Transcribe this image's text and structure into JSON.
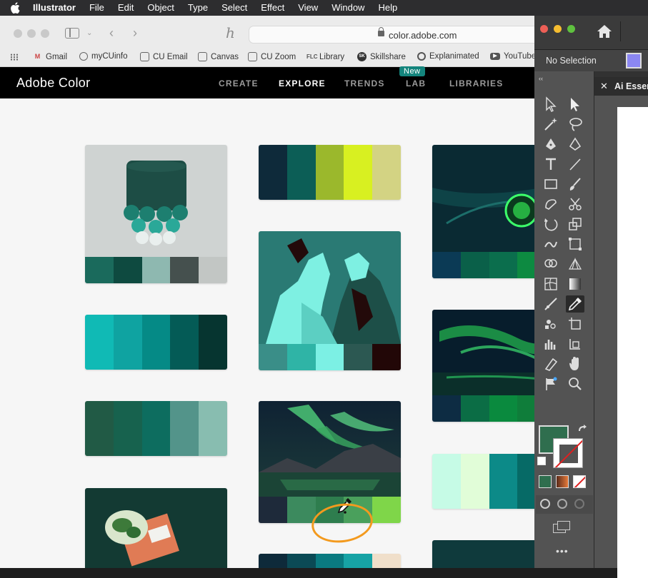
{
  "menubar": {
    "app": "Illustrator",
    "items": [
      "File",
      "Edit",
      "Object",
      "Type",
      "Select",
      "Effect",
      "View",
      "Window",
      "Help"
    ]
  },
  "browser": {
    "url": "color.adobe.com",
    "bookmarks": [
      {
        "label": "Gmail",
        "icon": "gmail-icon"
      },
      {
        "label": "myCUinfo",
        "icon": "globe-icon"
      },
      {
        "label": "CU Email",
        "icon": "email-icon"
      },
      {
        "label": "Canvas",
        "icon": "canvas-icon"
      },
      {
        "label": "CU Zoom",
        "icon": "zoom-icon"
      },
      {
        "label": "Library",
        "icon": "library-icon"
      },
      {
        "label": "Skillshare",
        "icon": "skillshare-icon"
      },
      {
        "label": "Explanimated",
        "icon": "explanimated-icon"
      },
      {
        "label": "YouTube",
        "icon": "youtube-icon"
      }
    ]
  },
  "adobe_color": {
    "logo": "Adobe Color",
    "nav": [
      "CREATE",
      "EXPLORE",
      "TRENDS",
      "LAB",
      "LIBRARIES"
    ],
    "active": "EXPLORE",
    "new_badge": "New",
    "themes": [
      {
        "swatches": [
          "#1a6a5c",
          "#0e4a40",
          "#8eb8b0",
          "#45504e",
          "#c2c6c4"
        ]
      },
      {
        "swatches": [
          "#0e2a3a",
          "#0c5e56",
          "#9bb82c",
          "#d8f021",
          "#d3d383"
        ]
      },
      {
        "swatches": [
          "#0b3a55",
          "#0a6049",
          "#0b6e4d",
          "#0d8a41",
          "#0b7c3a"
        ]
      },
      {
        "swatches": [
          "#10bab5",
          "#0fa3a1",
          "#058a86",
          "#045b56",
          "#063530"
        ]
      },
      {
        "swatches": [
          "#3a8e88",
          "#2fb4a6",
          "#7cf0e4",
          "#2c5852",
          "#220707"
        ]
      },
      {
        "swatches": [
          "#0d2c43",
          "#0b6d45",
          "#0a8a3e",
          "#0f7d3a",
          "#09642e"
        ]
      },
      {
        "swatches": [
          "#215a45",
          "#17624e",
          "#0d6d5f",
          "#53948a",
          "#88bdb0"
        ]
      },
      {
        "swatches": [
          "#c6fbe6",
          "#e1fdd8",
          "#0c8a88",
          "#066a66",
          "#044a48"
        ]
      },
      {
        "swatches": [
          "#1e2a3a",
          "#3c8a5e",
          "#2e7d4e",
          "#4aa05c",
          "#7fd649"
        ]
      }
    ]
  },
  "illustrator": {
    "control_text": "No Selection",
    "panel_tab": "Ai Essentials",
    "fill_color": "#8b87f2",
    "current_fill": "#2f6e4e"
  }
}
